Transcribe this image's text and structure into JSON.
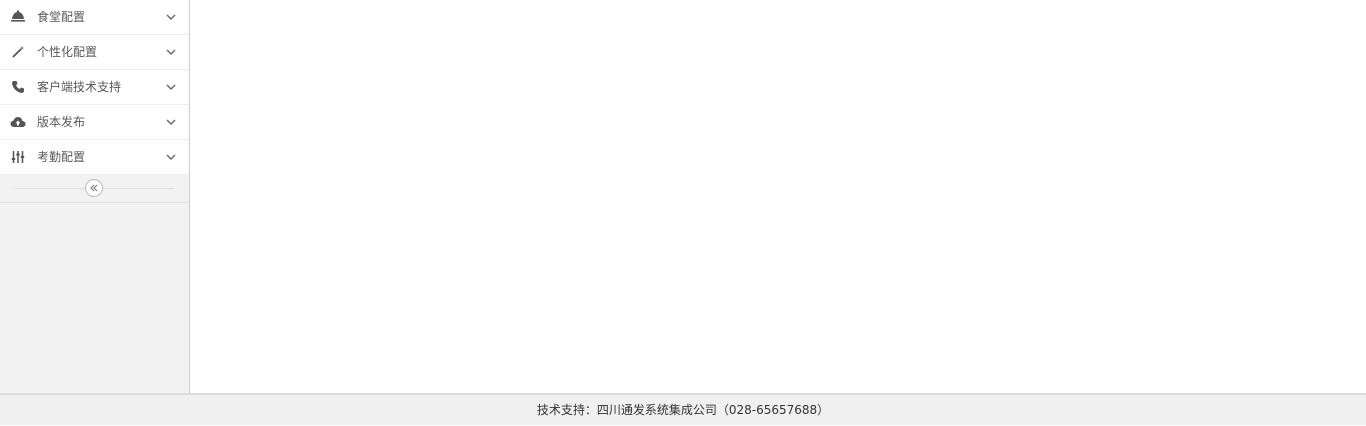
{
  "sidebar": {
    "items": [
      {
        "label": "食堂配置",
        "icon": "canteen-bell-icon"
      },
      {
        "label": "个性化配置",
        "icon": "magic-wand-icon"
      },
      {
        "label": "客户端技术支持",
        "icon": "phone-icon"
      },
      {
        "label": "版本发布",
        "icon": "cloud-upload-icon"
      },
      {
        "label": "考勤配置",
        "icon": "sliders-icon"
      }
    ],
    "collapse_icon": "double-chevron-left-icon"
  },
  "footer": {
    "text": "技术支持：四川通发系统集成公司（028-65657688）"
  },
  "colors": {
    "sidebar_bg": "#f2f2f2",
    "footer_bg": "#f0f0f0",
    "text": "#585858"
  }
}
